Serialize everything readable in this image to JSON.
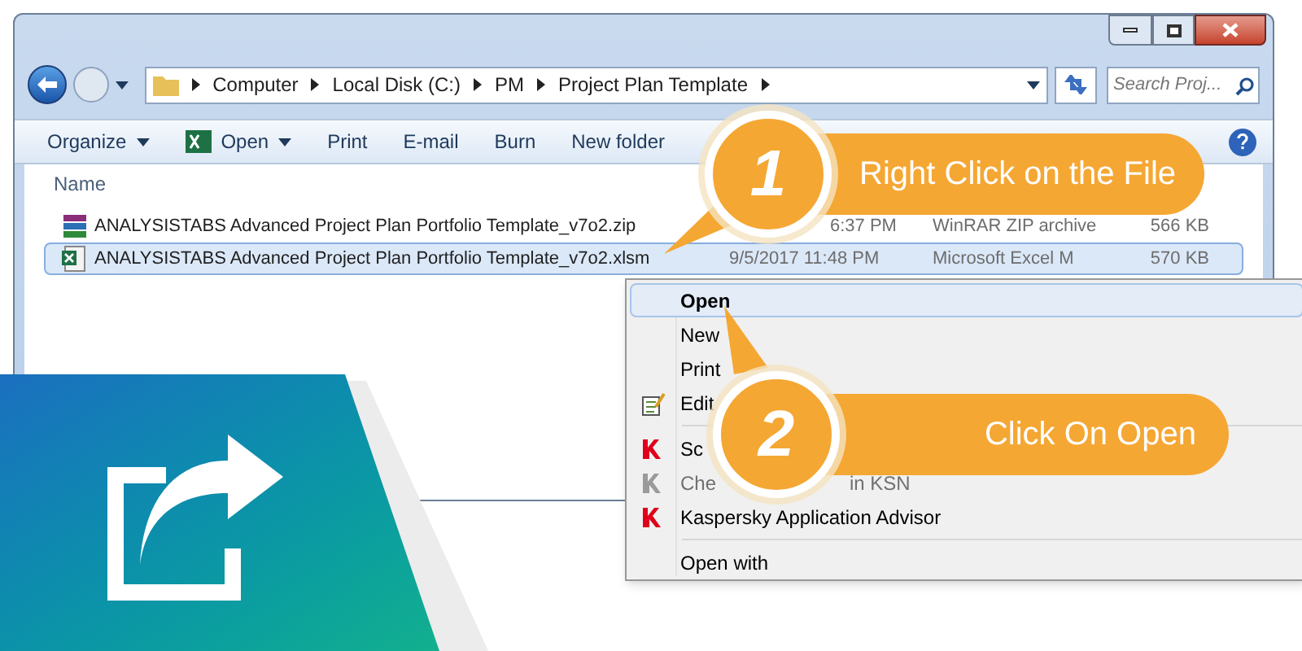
{
  "address_bar": {
    "path": [
      "Computer",
      "Local Disk (C:)",
      "PM",
      "Project Plan Template"
    ],
    "search_placeholder": "Search Proj..."
  },
  "toolbar": [
    {
      "label": "Organize",
      "kind": "menu"
    },
    {
      "label": "Open",
      "kind": "excel-menu"
    },
    {
      "label": "Print",
      "kind": "plain"
    },
    {
      "label": "E-mail",
      "kind": "plain"
    },
    {
      "label": "Burn",
      "kind": "plain"
    },
    {
      "label": "New folder",
      "kind": "plain"
    }
  ],
  "columns": [
    "Name"
  ],
  "files": [
    {
      "name": "ANALYSISTABS Advanced Project Plan Portfolio Template_v7o2.zip",
      "date": "6:37 PM",
      "type": "WinRAR ZIP archive",
      "size": "566 KB",
      "kind": "zip",
      "selected": false
    },
    {
      "name": "ANALYSISTABS Advanced Project Plan Portfolio Template_v7o2.xlsm",
      "date": "9/5/2017 11:48 PM",
      "type": "Microsoft Excel M",
      "size": "570 KB",
      "kind": "excel",
      "selected": true
    }
  ],
  "context_menu": [
    {
      "label": "Open",
      "kind": "plain",
      "bold": true,
      "selected": true,
      "disabled": false
    },
    {
      "label": "New",
      "kind": "plain",
      "bold": false,
      "selected": false,
      "disabled": false
    },
    {
      "label": "Print",
      "kind": "plain",
      "bold": false,
      "selected": false,
      "disabled": false
    },
    {
      "label": "Edit",
      "kind": "edit",
      "bold": false,
      "selected": false,
      "disabled": false
    },
    {
      "kind": "separator"
    },
    {
      "label": "Sc",
      "kind": "k",
      "bold": false,
      "selected": false,
      "disabled": false
    },
    {
      "label": "Che",
      "label_tail": "in KSN",
      "kind": "k",
      "bold": false,
      "selected": false,
      "disabled": true
    },
    {
      "label": "Kaspersky Application Advisor",
      "kind": "k",
      "bold": false,
      "selected": false,
      "disabled": false
    },
    {
      "kind": "separator"
    },
    {
      "label": "Open with",
      "kind": "plain",
      "bold": false,
      "selected": false,
      "disabled": false
    }
  ],
  "callouts": [
    {
      "number": "1",
      "text": "Right Click on the File"
    },
    {
      "number": "2",
      "text": "Click On Open"
    }
  ]
}
